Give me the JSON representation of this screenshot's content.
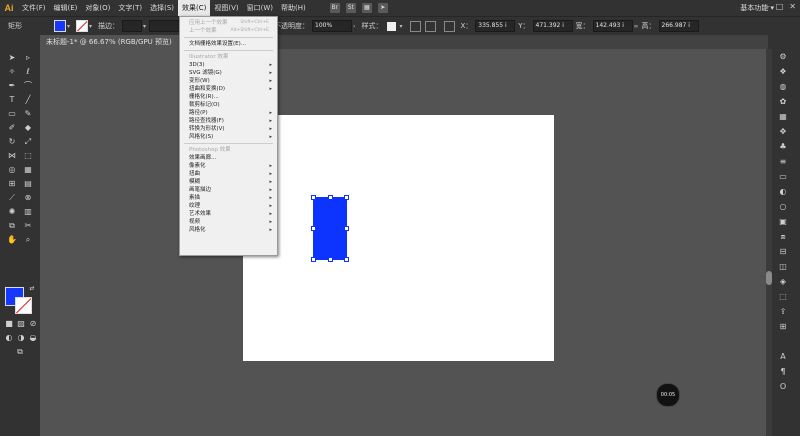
{
  "app": {
    "logo": "Ai"
  },
  "menubar": {
    "items": [
      "文件(F)",
      "编辑(E)",
      "对象(O)",
      "文字(T)",
      "选择(S)",
      "效果(C)",
      "视图(V)",
      "窗口(W)",
      "帮助(H)"
    ],
    "icons": [
      {
        "label": "Br",
        "name": "bridge-icon"
      },
      {
        "label": "St",
        "name": "stock-icon"
      },
      {
        "label": "▦",
        "name": "arrange-icon"
      },
      {
        "label": "➤",
        "name": "publish-icon"
      }
    ],
    "workspace": "基本功能",
    "window_controls": [
      "–",
      "□",
      "✕"
    ]
  },
  "control_bar": {
    "object_type": "矩形",
    "stroke_label": "描边：",
    "opacity_label": "不透明度：",
    "opacity_value": "100%",
    "style_label": "样式：",
    "x_label": "X：",
    "x_value": "335.855 i",
    "y_label": "Y：",
    "y_value": "471.392 i",
    "w_label": "宽：",
    "w_value": "142.493 i",
    "h_label": "高：",
    "h_value": "266.987 i",
    "fill_color": "#1637ff"
  },
  "document": {
    "tab_title": "未标题-1* @ 66.67% (RGB/GPU 预览)",
    "close": "×"
  },
  "effect_menu": {
    "items": [
      {
        "label": "应用上一个效果",
        "shortcut": "Shift+Ctrl+E",
        "disabled": true
      },
      {
        "label": "上一个效果",
        "shortcut": "Alt+Shift+Ctrl+E",
        "disabled": true
      },
      {
        "label": "文档栅格效果设置(E)...",
        "separator_before": true
      },
      {
        "label": "Illustrator 效果",
        "header": true,
        "separator_before": true
      },
      {
        "label": "3D(3)",
        "submenu": true
      },
      {
        "label": "SVG 滤镜(G)",
        "submenu": true
      },
      {
        "label": "变形(W)",
        "submenu": true
      },
      {
        "label": "扭曲和变换(D)",
        "submenu": true
      },
      {
        "label": "栅格化(R)..."
      },
      {
        "label": "裁剪标记(O)"
      },
      {
        "label": "路径(P)",
        "submenu": true
      },
      {
        "label": "路径查找器(F)",
        "submenu": true
      },
      {
        "label": "转换为形状(V)",
        "submenu": true
      },
      {
        "label": "风格化(S)",
        "submenu": true
      },
      {
        "label": "Photoshop 效果",
        "header": true,
        "separator_before": true
      },
      {
        "label": "效果画廊..."
      },
      {
        "label": "像素化",
        "submenu": true
      },
      {
        "label": "扭曲",
        "submenu": true
      },
      {
        "label": "模糊",
        "submenu": true
      },
      {
        "label": "画笔描边",
        "submenu": true
      },
      {
        "label": "素描",
        "submenu": true
      },
      {
        "label": "纹理",
        "submenu": true
      },
      {
        "label": "艺术效果",
        "submenu": true
      },
      {
        "label": "视频",
        "submenu": true
      },
      {
        "label": "风格化",
        "submenu": true
      }
    ]
  },
  "timer": {
    "value": "00:05"
  },
  "colors": {
    "accent": "#0d33ff",
    "chrome_dark": "#323232",
    "canvas": "#535353"
  }
}
